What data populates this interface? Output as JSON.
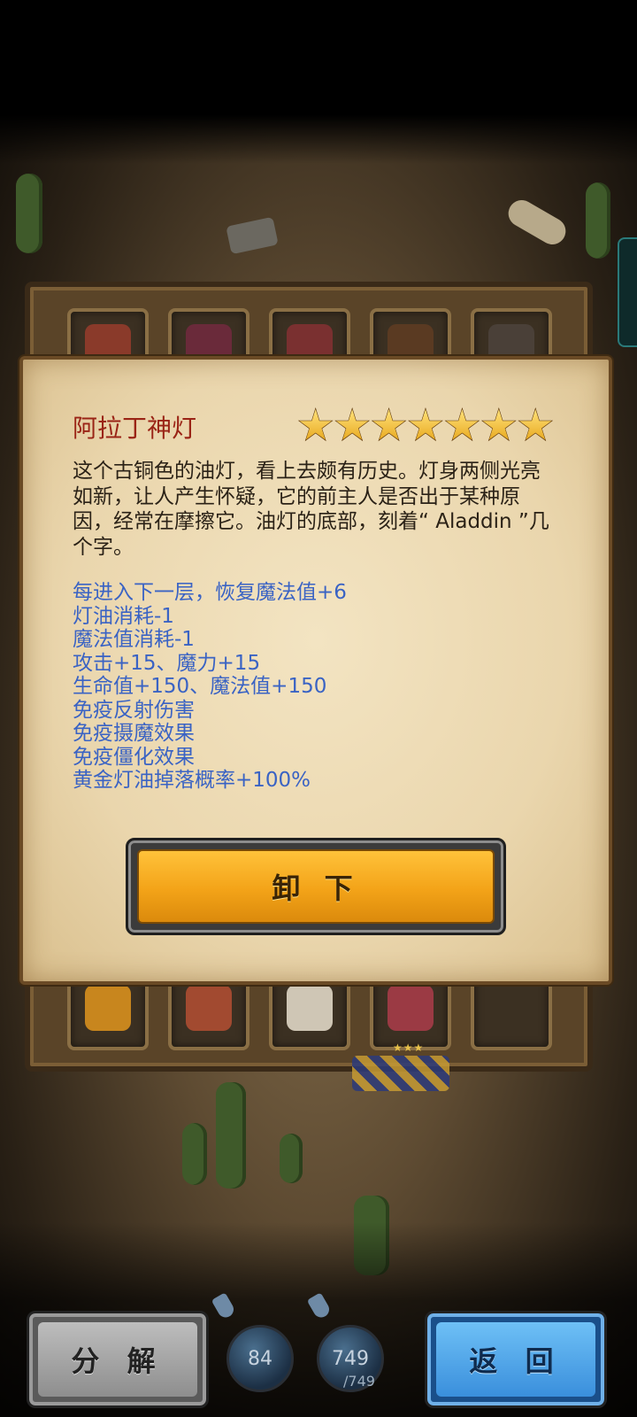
{
  "item": {
    "name": "阿拉丁神灯",
    "stars": 7,
    "description": "这个古铜色的油灯，看上去颇有历史。灯身两侧光亮如新，让人产生怀疑，它的前主人是否出于某种原因，经常在摩擦它。油灯的底部，刻着“ Aladdin ”几个字。",
    "effects": [
      "每进入下一层，恢复魔法值+6",
      "灯油消耗-1",
      "魔法值消耗-1",
      "攻击+15、魔力+15",
      "生命值+150、魔法值+150",
      "免疫反射伤害",
      "免疫摄魔效果",
      "免疫僵化效果",
      "黄金灯油掉落概率+100%"
    ]
  },
  "buttons": {
    "unequip": "卸 下",
    "decompose": "分 解",
    "back": "返 回"
  },
  "resources": {
    "oil": "84",
    "mana_current": "749",
    "mana_max": "/749"
  },
  "colors": {
    "item_name": "#9a2416",
    "effects_text": "#3a63c4",
    "star": "#f2b62a",
    "unequip_button": "#f3a318",
    "back_button": "#3a8fdc"
  }
}
